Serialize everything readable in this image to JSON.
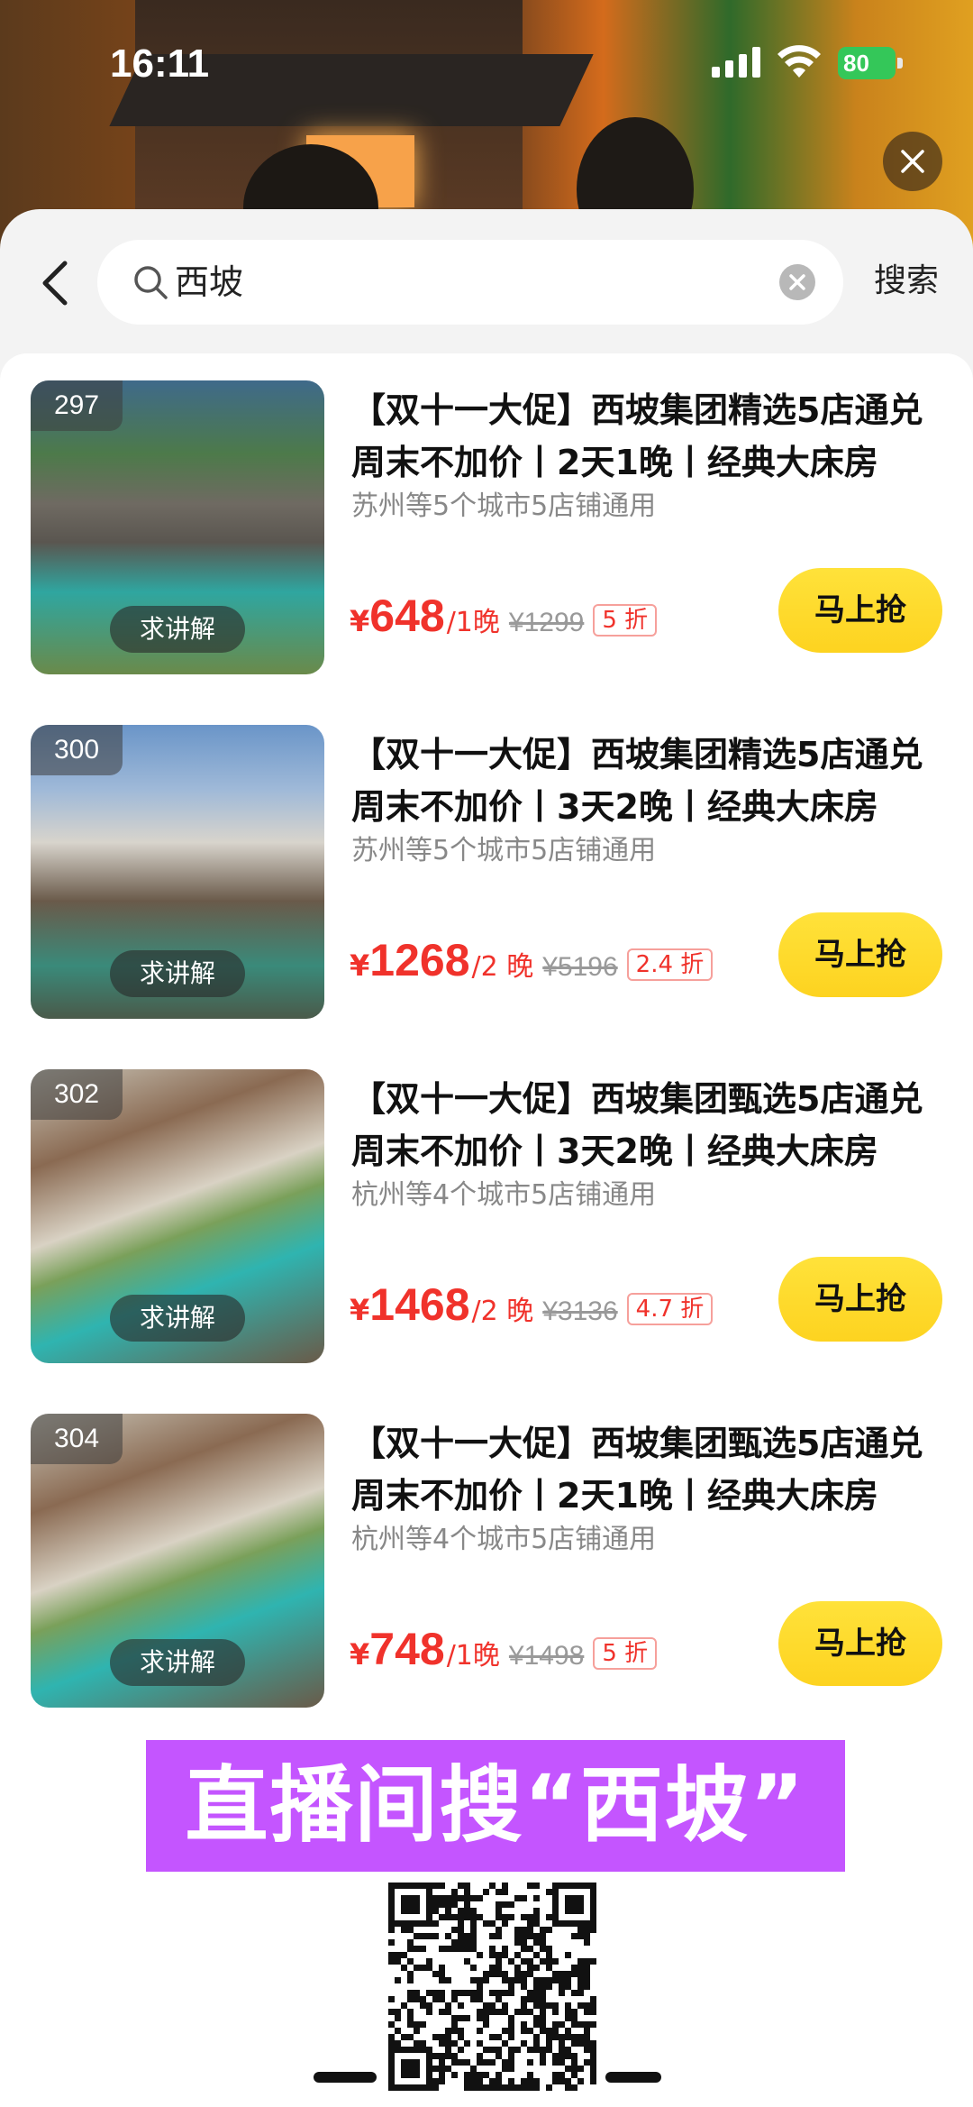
{
  "status_bar": {
    "time": "16:11",
    "battery": "80"
  },
  "search": {
    "query": "西坡",
    "button_label": "搜索"
  },
  "items": [
    {
      "badge": "297",
      "explain_label": "求讲解",
      "title": "【双十一大促】西坡集团精选5店通兑周末不加价丨2天1晚丨经典大床房",
      "subtitle": "苏州等5个城市5店铺通用",
      "currency": "¥",
      "price": "648",
      "unit": "/1晚",
      "original_price": "¥1299",
      "discount": "5 折",
      "buy_label": "马上抢"
    },
    {
      "badge": "300",
      "explain_label": "求讲解",
      "title": "【双十一大促】西坡集团精选5店通兑周末不加价丨3天2晚丨经典大床房",
      "subtitle": "苏州等5个城市5店铺通用",
      "currency": "¥",
      "price": "1268",
      "unit": "/2 晚",
      "original_price": "¥5196",
      "discount": "2.4 折",
      "buy_label": "马上抢"
    },
    {
      "badge": "302",
      "explain_label": "求讲解",
      "title": "【双十一大促】西坡集团甄选5店通兑周末不加价丨3天2晚丨经典大床房",
      "subtitle": "杭州等4个城市5店铺通用",
      "currency": "¥",
      "price": "1468",
      "unit": "/2 晚",
      "original_price": "¥3136",
      "discount": "4.7 折",
      "buy_label": "马上抢"
    },
    {
      "badge": "304",
      "explain_label": "求讲解",
      "title": "【双十一大促】西坡集团甄选5店通兑周末不加价丨2天1晚丨经典大床房",
      "subtitle": "杭州等4个城市5店铺通用",
      "currency": "¥",
      "price": "748",
      "unit": "/1晚",
      "original_price": "¥1498",
      "discount": "5 折",
      "buy_label": "马上抢"
    }
  ],
  "promo": {
    "text": "直播间搜“西坡”"
  },
  "colors": {
    "accent_price": "#f0322b",
    "buy_button": "#fdd320",
    "promo_bg": "#c455ff"
  }
}
